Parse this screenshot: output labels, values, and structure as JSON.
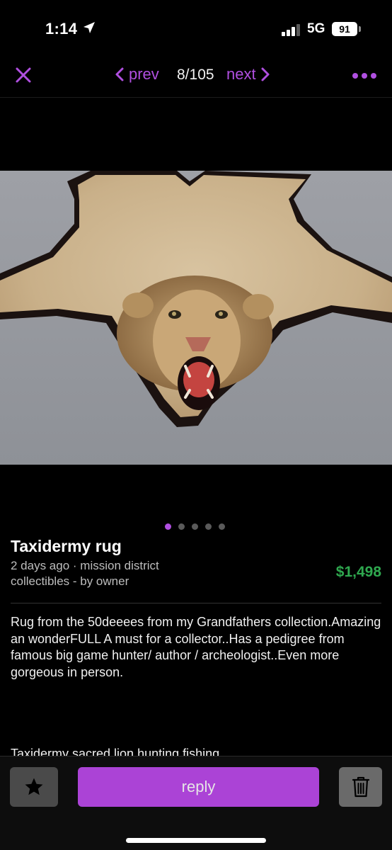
{
  "status_bar": {
    "time": "1:14",
    "network": "5G",
    "battery": "91"
  },
  "nav": {
    "prev_label": "prev",
    "position": "8/105",
    "next_label": "next",
    "icons": {
      "close": "close-icon",
      "prev": "chevron-left-icon",
      "next": "chevron-right-icon",
      "more": "more-dots-icon"
    }
  },
  "gallery": {
    "total_dots": 5,
    "active_index": 0
  },
  "listing": {
    "title": "Taxidermy rug",
    "meta_line1": "2 days ago · mission district",
    "meta_line2": "collectibles - by owner",
    "price": "$1,498",
    "description": "Rug from the 50deeees from my Grandfathers collection.Amazing an wonderFULL A must for a collector..Has a pedigree from famous big game hunter/ author / archeologist..Even more gorgeous in person.",
    "tags": "Taxidermy sacred lion hunting fishing"
  },
  "actions": {
    "reply_label": "reply",
    "icons": {
      "favorite": "star-icon",
      "delete": "trash-icon"
    }
  },
  "colors": {
    "accent": "#b04fe0",
    "reply_button": "#ab43d6",
    "price": "#2fa84f",
    "background": "#000000"
  }
}
